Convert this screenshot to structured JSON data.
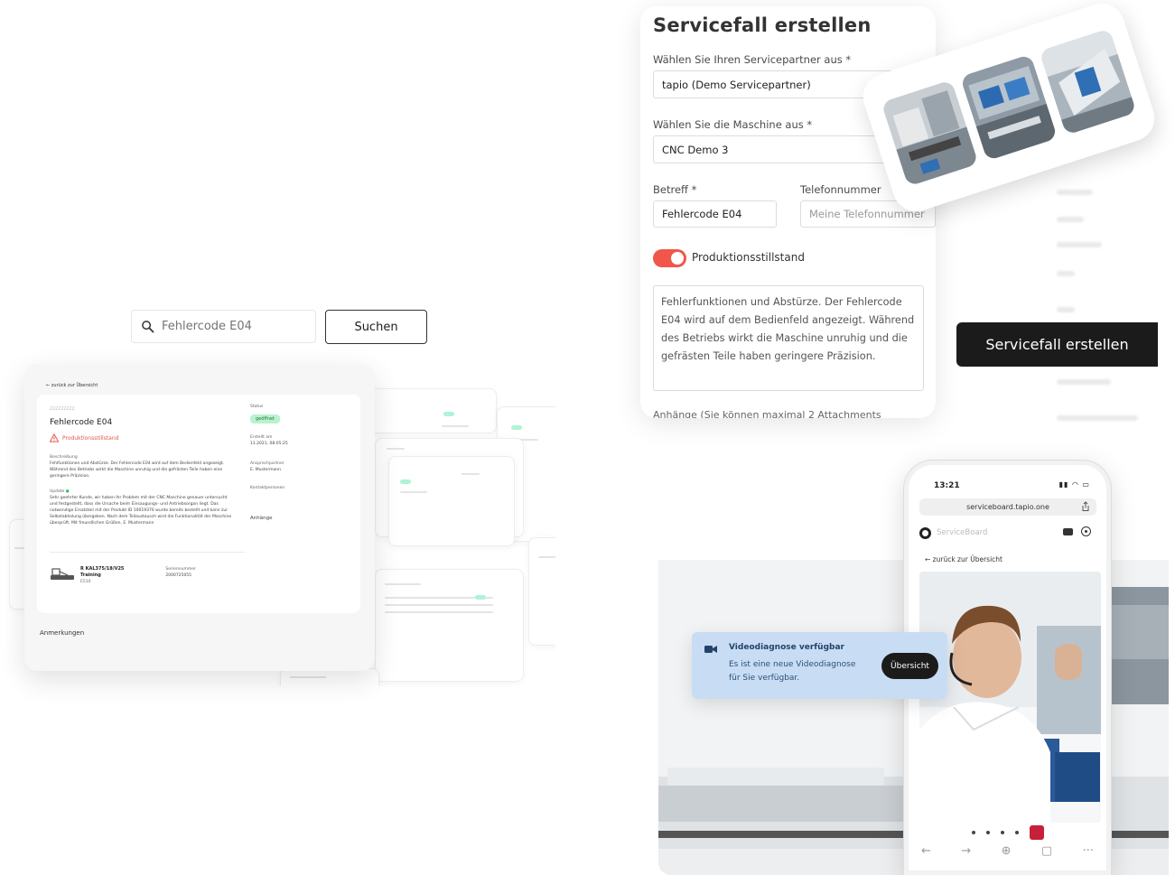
{
  "search": {
    "placeholder": "Fehlercode E04",
    "button_label": "Suchen"
  },
  "ticket": {
    "back_label": "zurück zur Übersicht",
    "meta_label": "ZZZZZZZZZ",
    "title": "Fehlercode E04",
    "warning": "Produktionsstillstand",
    "description_label": "Beschreibung",
    "description": "Fehlfunktionen und Abstürze. Der Fehlercode E04 wird auf dem Bedienfeld angezeigt. Während des Betriebs wirkt die Maschine unruhig und die gefrästen Teile haben eine geringere Präzision.",
    "update_label": "Update",
    "update_text": "Sehr geehrter Kunde, wir haben Ihr Problem mit der CNC Maschine genauer untersucht und festgestellt, dass die Ursache beim Einsaugungs- und Antriebsorgan liegt. Das notwendige Ersatzteil mit der Produkt ID 10019376 wurde bereits bestellt und kann zur Selbstabholung übergeben. Nach dem Teilaustausch wird die Funktionalität der Maschine überprüft. Mit freundlichen Grüßen, E. Mustermann",
    "status_label": "Status",
    "status": "geöffnet",
    "created_label": "Erstellt am",
    "created": "11.2021, 08:05:25",
    "assigned_label": "Ansprechpartner",
    "assigned": "E. Mustermann",
    "contact_label": "Kontaktpersonen",
    "attachments_label": "Anhänge",
    "machine_name": "R KAL375/18/V25",
    "machine_sub": "Training",
    "machine_code": "E510",
    "serial_label": "Seriennummer",
    "serial": "2000725055",
    "notes_label": "Anmerkungen"
  },
  "form": {
    "title": "Servicefall erstellen",
    "partner_label": "Wählen Sie Ihren Servicepartner aus *",
    "partner_value": "tapio (Demo Servicepartner)",
    "machine_label": "Wählen Sie die Maschine aus *",
    "machine_value": "CNC Demo 3",
    "subject_label": "Betreff *",
    "subject_value": "Fehlercode E04",
    "phone_label": "Telefonnummer",
    "phone_placeholder": "Meine Telefonnummer",
    "toggle_label": "Produktionsstillstand",
    "description": "Fehlerfunktionen und Abstürze. Der Fehlercode E04 wird auf dem Bedienfeld angezeigt. Während des Betriebs wirkt die Maschine unruhig und die gefrästen Teile haben geringere Präzision.",
    "attachments_label": "Anhänge (Sie können maximal 2 Attachments"
  },
  "create_button": "Servicefall erstellen",
  "phone": {
    "time": "13:21",
    "url": "serviceboard.tapio.one",
    "app_name": "ServiceBoard",
    "back_label": "zurück zur Übersicht"
  },
  "notification": {
    "title": "Videodiagnose verfügbar",
    "text": "Es ist eine neue Videodiagnose für Sie verfügbar.",
    "button": "Übersicht"
  },
  "colors": {
    "accent_red": "#f0574a",
    "status_green": "#b9f3cd",
    "notification_blue": "#c8ddf3",
    "dark": "#1b1b1b"
  }
}
